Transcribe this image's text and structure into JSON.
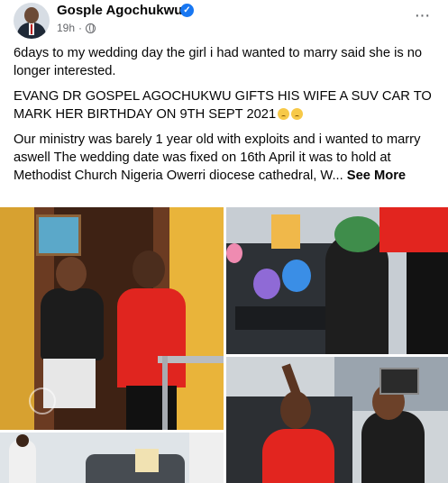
{
  "post": {
    "author": "Gosple Agochukwu",
    "time": "19h",
    "dot": "·",
    "paragraphs": [
      "6days to my wedding day the girl i had wanted to marry said she is no longer interested.",
      "EVANG DR GOSPEL AGOCHUKWU GIFTS HIS WIFE A SUV CAR TO MARK HER BIRTHDAY ON 9TH SEPT 2021"
    ],
    "last_paragraph": "Our ministry was barely 1 year old with exploits and i wanted to marry aswell The wedding date was fixed on 16th April it was to hold at Methodist Church Nigeria Owerri diocese cathedral, W...",
    "see_more": "See More",
    "more_options": "···"
  },
  "icons": {
    "verified": "verified-badge-icon",
    "privacy": "globe-icon",
    "menu": "more-options-icon"
  },
  "colors": {
    "accent": "#1877f2",
    "muted": "#65676b",
    "text": "#050505"
  }
}
